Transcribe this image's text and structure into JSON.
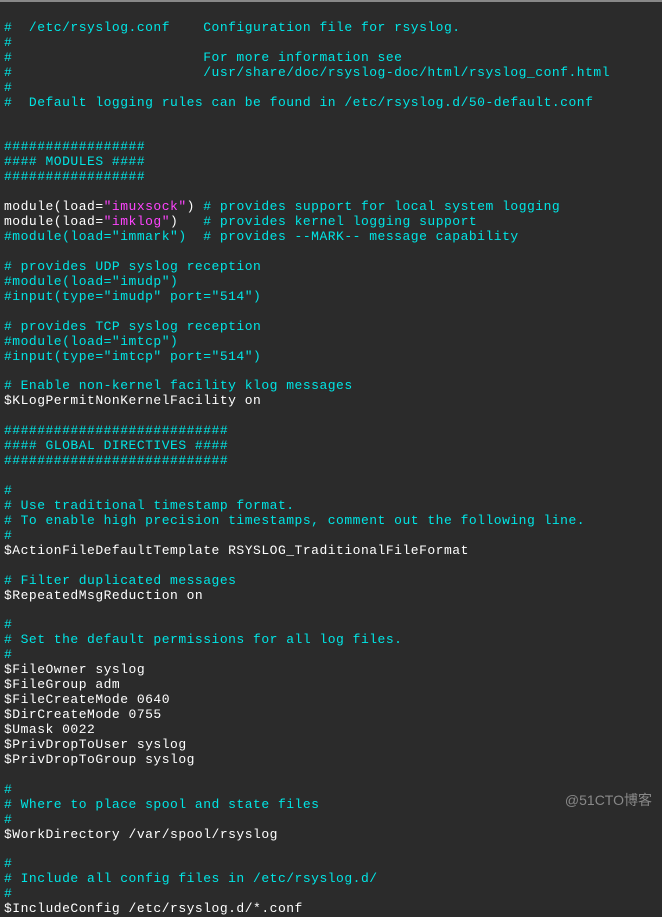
{
  "header": {
    "l1": "#  /etc/rsyslog.conf    Configuration file for rsyslog.",
    "l2": "#",
    "l3": "#                       For more information see",
    "l4": "#                       /usr/share/doc/rsyslog-doc/html/rsyslog_conf.html",
    "l5": "#",
    "l6": "#  Default logging rules can be found in /etc/rsyslog.d/50-default.conf"
  },
  "modules_banner": {
    "l1": "#################",
    "l2": "#### MODULES ####",
    "l3": "#################"
  },
  "module1": {
    "pre1": "module(load=",
    "str1": "\"imuxsock\"",
    "post1": ") ",
    "comment1": "# provides support for local system logging",
    "pre2": "module(load=",
    "str2": "\"imklog\"",
    "post2": ")   ",
    "comment2": "# provides kernel logging support",
    "l3": "#module(load=\"immark\")  # provides --MARK-- message capability"
  },
  "udp": {
    "l1": "# provides UDP syslog reception",
    "l2": "#module(load=\"imudp\")",
    "l3": "#input(type=\"imudp\" port=\"514\")"
  },
  "tcp": {
    "l1": "# provides TCP syslog reception",
    "l2": "#module(load=\"imtcp\")",
    "l3": "#input(type=\"imtcp\" port=\"514\")"
  },
  "klog": {
    "comment": "# Enable non-kernel facility klog messages",
    "directive": "$KLogPermitNonKernelFacility on"
  },
  "globals_banner": {
    "l1": "###########################",
    "l2": "#### GLOBAL DIRECTIVES ####",
    "l3": "###########################"
  },
  "timestamp": {
    "l1": "#",
    "l2": "# Use traditional timestamp format.",
    "l3": "# To enable high precision timestamps, comment out the following line.",
    "l4": "#",
    "directive": "$ActionFileDefaultTemplate RSYSLOG_TraditionalFileFormat"
  },
  "filter": {
    "comment": "# Filter duplicated messages",
    "directive": "$RepeatedMsgReduction on"
  },
  "perms": {
    "l1": "#",
    "l2": "# Set the default permissions for all log files.",
    "l3": "#",
    "d1": "$FileOwner syslog",
    "d2": "$FileGroup adm",
    "d3": "$FileCreateMode 0640",
    "d4": "$DirCreateMode 0755",
    "d5": "$Umask 0022",
    "d6": "$PrivDropToUser syslog",
    "d7": "$PrivDropToGroup syslog"
  },
  "spool": {
    "l1": "#",
    "l2": "# Where to place spool and state files",
    "l3": "#",
    "directive": "$WorkDirectory /var/spool/rsyslog"
  },
  "include": {
    "l1": "#",
    "l2": "# Include all config files in /etc/rsyslog.d/",
    "l3": "#",
    "directive": "$IncludeConfig /etc/rsyslog.d/*.conf"
  },
  "watermark": "@51CTO博客"
}
